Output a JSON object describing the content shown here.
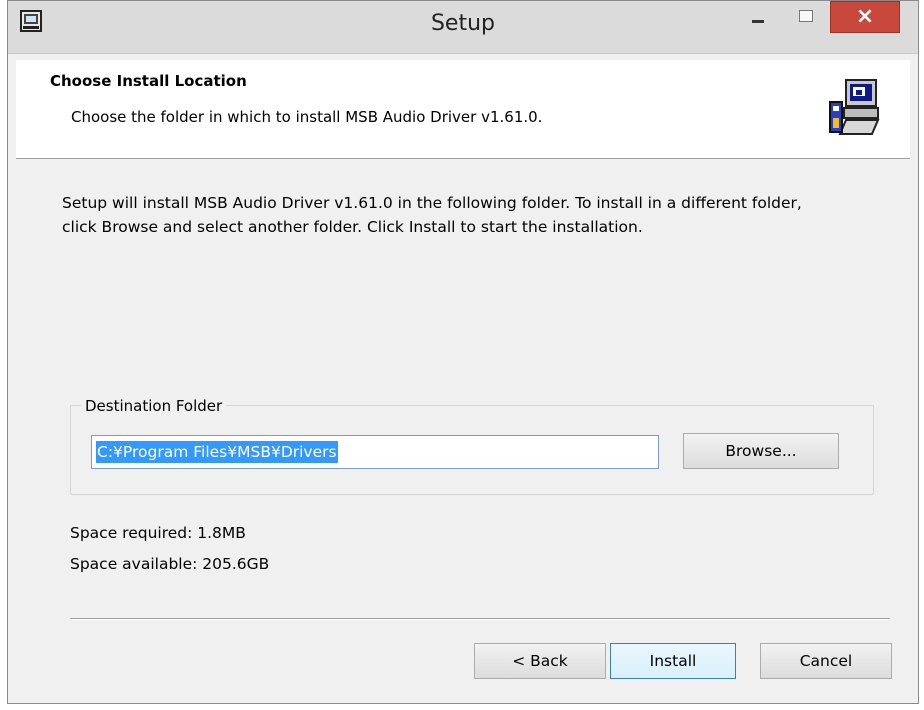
{
  "window": {
    "title": "Setup"
  },
  "header": {
    "title": "Choose Install Location",
    "subtitle": "Choose the folder in which to install MSB Audio Driver v1.61.0."
  },
  "body": {
    "description": "Setup will install MSB Audio Driver v1.61.0 in the following folder. To install in a different folder, click Browse and select another folder. Click Install to start the installation."
  },
  "destination": {
    "group_label": "Destination Folder",
    "path": "C:¥Program Files¥MSB¥Drivers",
    "browse_label": "Browse..."
  },
  "space": {
    "required": "Space required: 1.8MB",
    "available": "Space available: 205.6GB"
  },
  "buttons": {
    "back": "< Back",
    "install": "Install",
    "cancel": "Cancel"
  },
  "icons": {
    "window": "installer-app-icon",
    "header": "computer-install-icon",
    "close": "close-icon",
    "minimize": "minimize-icon",
    "maximize": "maximize-icon"
  },
  "colors": {
    "close_button": "#c9483c",
    "selection": "#3399ff"
  }
}
